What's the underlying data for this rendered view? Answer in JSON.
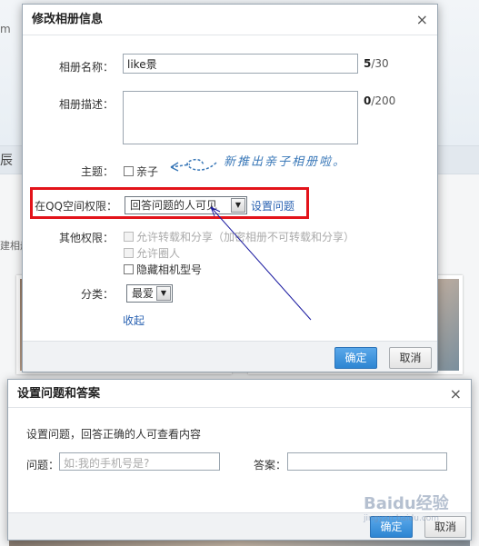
{
  "dialog_edit": {
    "title": "修改相册信息",
    "close": "×",
    "name_label": "相册名称：",
    "name_value": "like景",
    "name_count": "5",
    "name_max": "/30",
    "desc_label": "相册描述：",
    "desc_count": "0",
    "desc_max": "/200",
    "theme_label": "主题：",
    "theme_option": "亲子",
    "annotation": "新推出亲子相册啦。",
    "permission_label": "在QQ空间权限：",
    "permission_value": "回答问题的人可见",
    "set_question_link": "设置问题",
    "other_perm_label": "其他权限：",
    "other_perm_items": [
      "允许转载和分享（加密相册不可转载和分享）",
      "允许圈人",
      "隐藏相机型号"
    ],
    "category_label": "分类：",
    "category_value": "最爱",
    "collapse_link": "收起",
    "confirm_button": "确定",
    "cancel_button": "取消"
  },
  "dialog_question": {
    "title": "设置问题和答案",
    "close": "×",
    "hint": "设置问题，回答正确的人可查看内容",
    "question_label": "问题：",
    "question_placeholder": "如:我的手机号是?",
    "answer_label": "答案：",
    "confirm_button": "确定",
    "cancel_button": "取消"
  },
  "watermark": {
    "main": "Baidu经验",
    "sub": "jingyan.baidu.com"
  },
  "background": {
    "left_text_1": "m",
    "left_text_2": "辰",
    "left_text_3": "建相册"
  },
  "colors": {
    "highlight_red": "#e3131a",
    "arrow_blue": "#1a1aa0",
    "link_blue": "#2a62b2"
  }
}
